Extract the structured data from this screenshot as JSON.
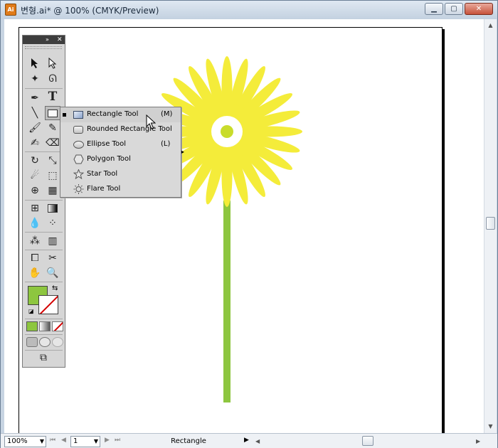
{
  "window": {
    "title": "변형.ai* @ 100% (CMYK/Preview)",
    "app_icon_text": "Ai",
    "minimize": "▁",
    "maximize": "▢",
    "close": "✕"
  },
  "colors": {
    "petal": "#f4ec3a",
    "center": "#c9dc2b",
    "stem": "#8dc63f",
    "fill_swatch": "#8dc63f"
  },
  "tools_panel": {
    "collapse_icon": "»",
    "close_icon": "✕"
  },
  "flyout": {
    "items": [
      {
        "label": "Rectangle Tool",
        "shortcut": "(M)",
        "icon": "rectangle-icon",
        "selected": true
      },
      {
        "label": "Rounded Rectangle Tool",
        "shortcut": "",
        "icon": "rounded-rectangle-icon",
        "selected": false
      },
      {
        "label": "Ellipse Tool",
        "shortcut": "(L)",
        "icon": "ellipse-icon",
        "selected": false
      },
      {
        "label": "Polygon Tool",
        "shortcut": "",
        "icon": "polygon-icon",
        "selected": false
      },
      {
        "label": "Star Tool",
        "shortcut": "",
        "icon": "star-icon",
        "selected": false
      },
      {
        "label": "Flare Tool",
        "shortcut": "",
        "icon": "flare-icon",
        "selected": false
      }
    ]
  },
  "statusbar": {
    "zoom": "100%",
    "page": "1",
    "current_tool": "Rectangle"
  }
}
